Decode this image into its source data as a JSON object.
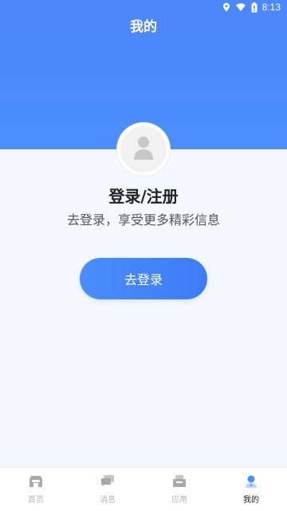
{
  "status_bar": {
    "time": "8:13"
  },
  "header": {
    "title": "我的"
  },
  "profile": {
    "title": "登录/注册",
    "subtitle": "去登录，享受更多精彩信息",
    "button": "去登录"
  },
  "tabbar": {
    "items": [
      {
        "label": "首页",
        "icon": "home-icon",
        "active": false
      },
      {
        "label": "消息",
        "icon": "message-icon",
        "active": false
      },
      {
        "label": "应用",
        "icon": "apps-icon",
        "active": false
      },
      {
        "label": "我的",
        "icon": "profile-icon",
        "active": true
      }
    ]
  },
  "colors": {
    "accent": "#4a8dfc",
    "header": "#4c87fb",
    "background": "#f4f7fb"
  }
}
